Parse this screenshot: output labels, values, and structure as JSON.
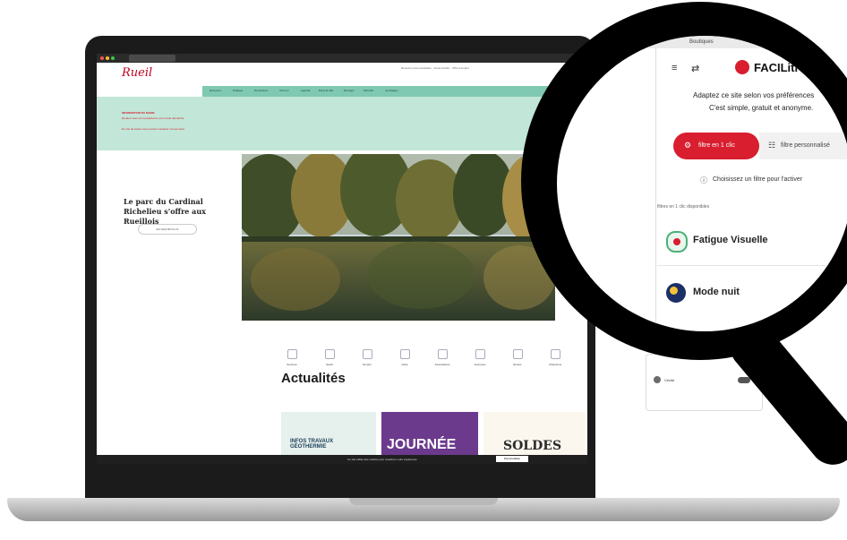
{
  "site": {
    "logo": "Rueil",
    "utility_text": "Recevoir notre newsletter · Accès handic · Offre d'emploi",
    "nav": [
      "Découvrir",
      "Pratique",
      "Démarches",
      "Vivre ici",
      "Agenda",
      "Dans la ville",
      "Écologie",
      "Sécurité",
      "Jumelages"
    ],
    "alert_title": "INFORMATION DU MAIRE",
    "alert_line1": "Rendez-vous sur la plateforme pour toute démarche",
    "alert_line2": "En cas de doute vous pouvez contacter nos services",
    "slide_text": "Le parc du Cardinal Richelieu s'offre aux Rueillois",
    "slide_button": "EN SAVOIR PLUS",
    "quick_links": [
      "Services",
      "Santé",
      "Emploi",
      "Carte",
      "Associations",
      "Jeunesse",
      "Écoles",
      "Urbanisme"
    ],
    "news_title": "Actualités",
    "news_cards": [
      "INFOS TRAVAUX GÉOTHERMIE",
      "JOURNÉE",
      "SOLDES"
    ],
    "cookie_text": "Ce site utilise des cookies pour améliorer votre expérience",
    "cookie_button": "Personnaliser"
  },
  "faciliti": {
    "top_label": "Boutiques",
    "brand": "FACILiti",
    "intro_line1": "Adaptez ce site selon vos préférences",
    "intro_line2": "C'est simple, gratuit et anonyme.",
    "tab_active": "filtre en 1 clic",
    "tab_inactive": "filtre personnalisé",
    "hint": "Choisissez un filtre pour l'activer",
    "section_label": "filtres en 1 clic disponibles",
    "filters": [
      "Fatigue Visuelle",
      "Mode nuit"
    ],
    "back_item": "Cécité",
    "accent": "#d81e2f"
  }
}
